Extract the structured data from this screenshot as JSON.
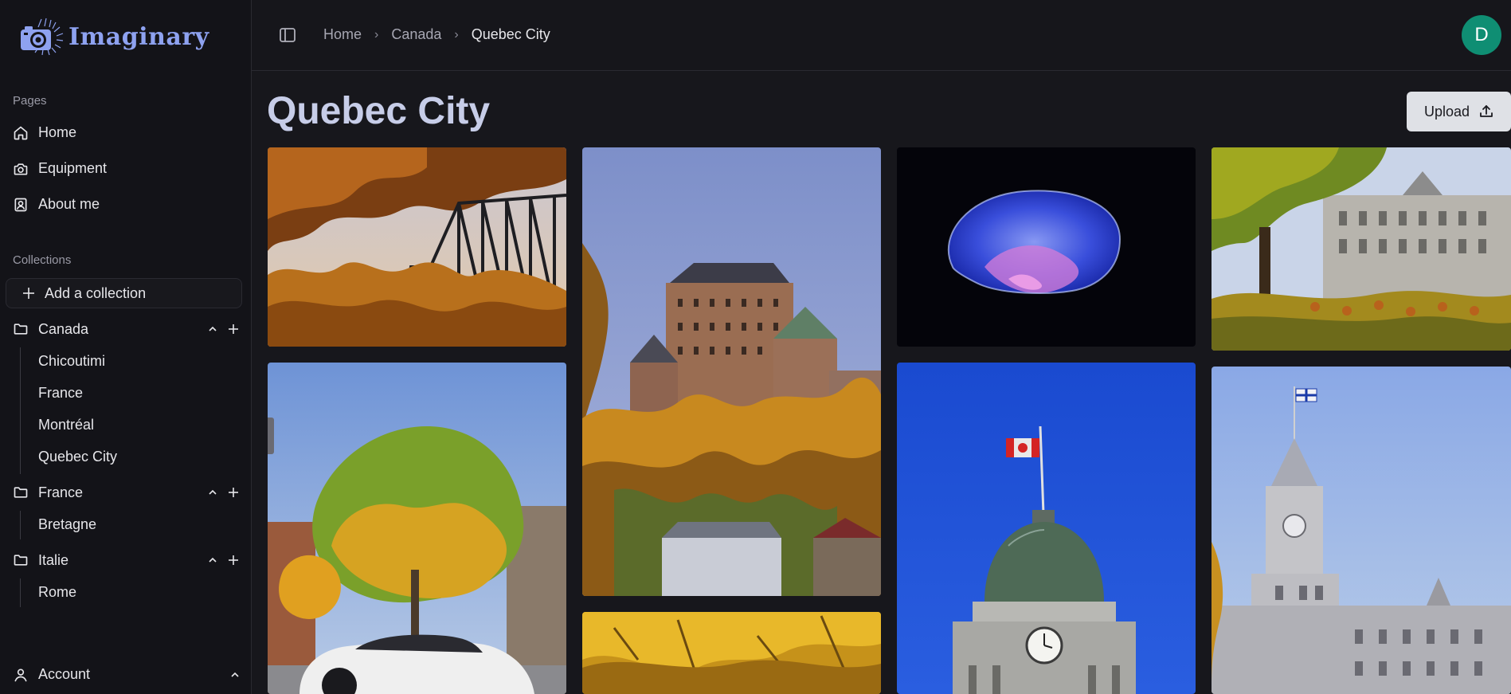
{
  "app": {
    "name": "Imaginary"
  },
  "sidebar": {
    "pages_label": "Pages",
    "pages": [
      {
        "label": "Home",
        "icon": "home-icon"
      },
      {
        "label": "Equipment",
        "icon": "camera-icon"
      },
      {
        "label": "About me",
        "icon": "contact-icon"
      }
    ],
    "collections_label": "Collections",
    "add_collection_label": "Add a collection",
    "collections": [
      {
        "name": "Canada",
        "children": [
          "Chicoutimi",
          "France",
          "Montréal",
          "Quebec City"
        ]
      },
      {
        "name": "France",
        "children": [
          "Bretagne"
        ]
      },
      {
        "name": "Italie",
        "children": [
          "Rome"
        ]
      }
    ],
    "account_label": "Account"
  },
  "header": {
    "breadcrumb": [
      "Home",
      "Canada",
      "Quebec City"
    ],
    "avatar_initial": "D"
  },
  "main": {
    "title": "Quebec City",
    "upload_label": "Upload"
  },
  "photos": [
    {
      "subject": "autumn-bridge"
    },
    {
      "subject": "chateau-frontenac"
    },
    {
      "subject": "jellyfish"
    },
    {
      "subject": "parliament-autumn"
    },
    {
      "subject": "sports-car"
    },
    {
      "subject": "canadian-flag-dome"
    },
    {
      "subject": "parliament-tower"
    },
    {
      "subject": "yellow-leaves"
    }
  ],
  "colors": {
    "accent_logo": "#8ea2f0",
    "avatar_bg": "#0f8e73",
    "title": "#c7cde8",
    "upload_bg": "#dfe1e6"
  }
}
